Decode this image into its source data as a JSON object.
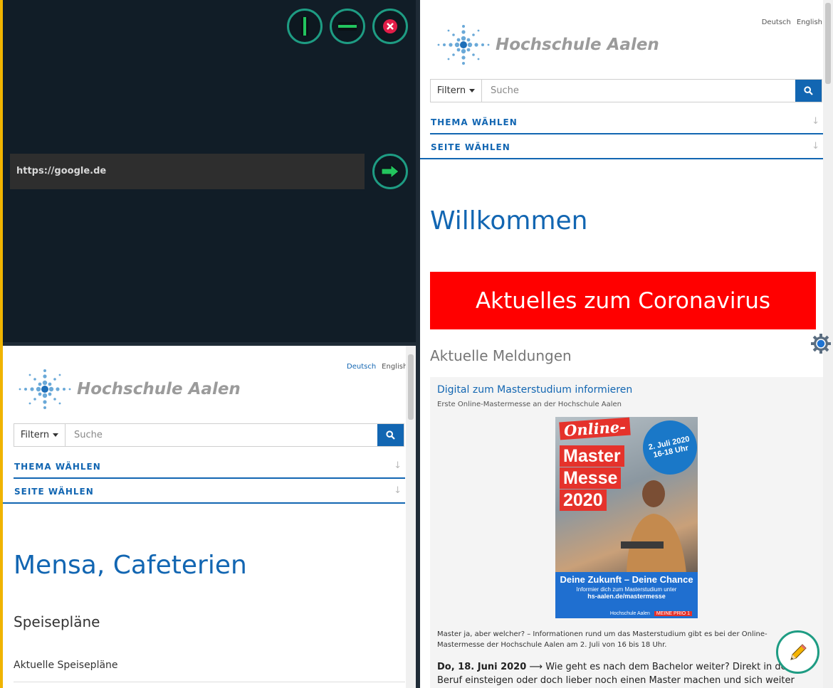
{
  "controls": {
    "url_value": "https://google.de",
    "buttons": [
      "split-vertical",
      "split-horizontal",
      "close"
    ],
    "accent_color": "#1e9c83"
  },
  "right_pane": {
    "lang": {
      "de": "Deutsch",
      "en": "English"
    },
    "logo_text": "Hochschule Aalen",
    "search": {
      "filter_label": "Filtern",
      "placeholder": "Suche"
    },
    "dropdowns": [
      "THEMA WÄHLEN",
      "SEITE WÄHLEN"
    ],
    "heading": "Willkommen",
    "banner": "Aktuelles zum Coronavirus",
    "section_title": "Aktuelle Meldungen",
    "news": {
      "title": "Digital zum Masterstudium informieren",
      "subtitle": "Erste Online-Mastermesse an der Hochschule Aalen",
      "poster": {
        "online": "Online-",
        "line1": "Master",
        "line2": "Messe",
        "line3": "2020",
        "seal_date": "2. Juli 2020",
        "seal_time": "16-18 Uhr",
        "tagline": "Deine Zukunft – Deine Chance",
        "info": "Informier dich zum Masterstudium unter",
        "url": "hs-aalen.de/mastermesse",
        "footer_logo": "Hochschule Aalen",
        "footer_prio": "MEINE PRIO 1"
      },
      "text": "Master ja, aber welcher? – Informationen rund um das Masterstudium gibt es bei der Online-Mastermesse der Hochschule Aalen am 2. Juli von 16 bis 18 Uhr.",
      "date": "Do, 18. Juni 2020",
      "date_text": "Wie geht es nach dem Bachelor weiter? Direkt in den Beruf einsteigen oder doch lieber noch einen Master machen und sich weiter spezialisieren?"
    }
  },
  "left_pane": {
    "lang": {
      "de": "Deutsch",
      "en": "English"
    },
    "logo_text": "Hochschule Aalen",
    "search": {
      "filter_label": "Filtern",
      "placeholder": "Suche"
    },
    "dropdowns": [
      "THEMA WÄHLEN",
      "SEITE WÄHLEN"
    ],
    "heading": "Mensa, Cafeterien",
    "subheading": "Speisepläne",
    "link": "Aktuelle Speisepläne"
  }
}
